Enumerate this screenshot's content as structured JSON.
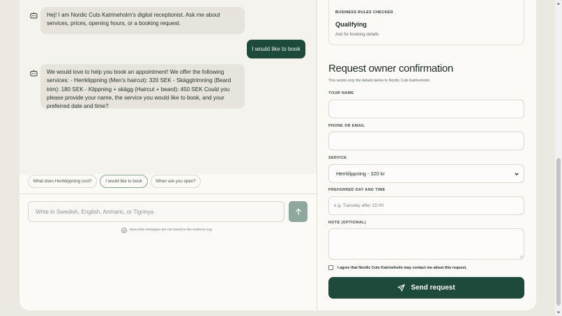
{
  "chat": {
    "messages": [
      {
        "role": "bot",
        "text": "Hej! I am Nordic Cuts Katrineholm's digital receptionist. Ask me about services, prices, opening hours, or a booking request."
      },
      {
        "role": "user",
        "text": "I would like to book"
      },
      {
        "role": "bot",
        "text": "We would love to help you book an appointment! We offer the following services: - Herrklippning (Men's haircut): 320 SEK - Skäggtrimning (Beard trim): 180 SEK - Klippning + skägg (Haircut + beard): 450 SEK Could you please provide your name, the service you would like to book, and your preferred date and time?"
      }
    ],
    "suggestions": [
      "What does Herrklippning cost?",
      "I would like to book",
      "When are you open?"
    ],
    "input_placeholder": "Write in Swedish, English, Amharic, or Tigrinya",
    "privacy_note": "Raw chat messages are not stored in the evidence log."
  },
  "rules": {
    "kicker": "BUSINESS RULES CHECKED",
    "status": "Qualifying",
    "detail": "Ask for booking details"
  },
  "form": {
    "title": "Request owner confirmation",
    "subtitle": "This sends only the details below to Nordic Cuts Katrineholm.",
    "name_label": "YOUR NAME",
    "name_value": "",
    "contact_label": "PHONE OR EMAIL",
    "contact_value": "",
    "service_label": "SERVICE",
    "service_value": "Herrklippning - 320 kr",
    "time_label": "PREFERRED DAY AND TIME",
    "time_placeholder": "e.g. Tuesday after 15:00",
    "note_label": "NOTE (OPTIONAL)",
    "note_value": "",
    "consent_text": "I agree that Nordic Cuts Katrineholm may contact me about this request.",
    "consent_checked": false,
    "submit_label": "Send request"
  },
  "colors": {
    "primary": "#1d4a3a",
    "bot_bubble": "#e6e4dc",
    "send_arrow": "#8fa89d",
    "background": "#ece9e2"
  },
  "icons": {
    "bot": "robot-icon",
    "send": "arrow-up-icon",
    "privacy": "shield-icon",
    "submit": "paper-plane-icon",
    "select": "chevron-down-icon"
  }
}
